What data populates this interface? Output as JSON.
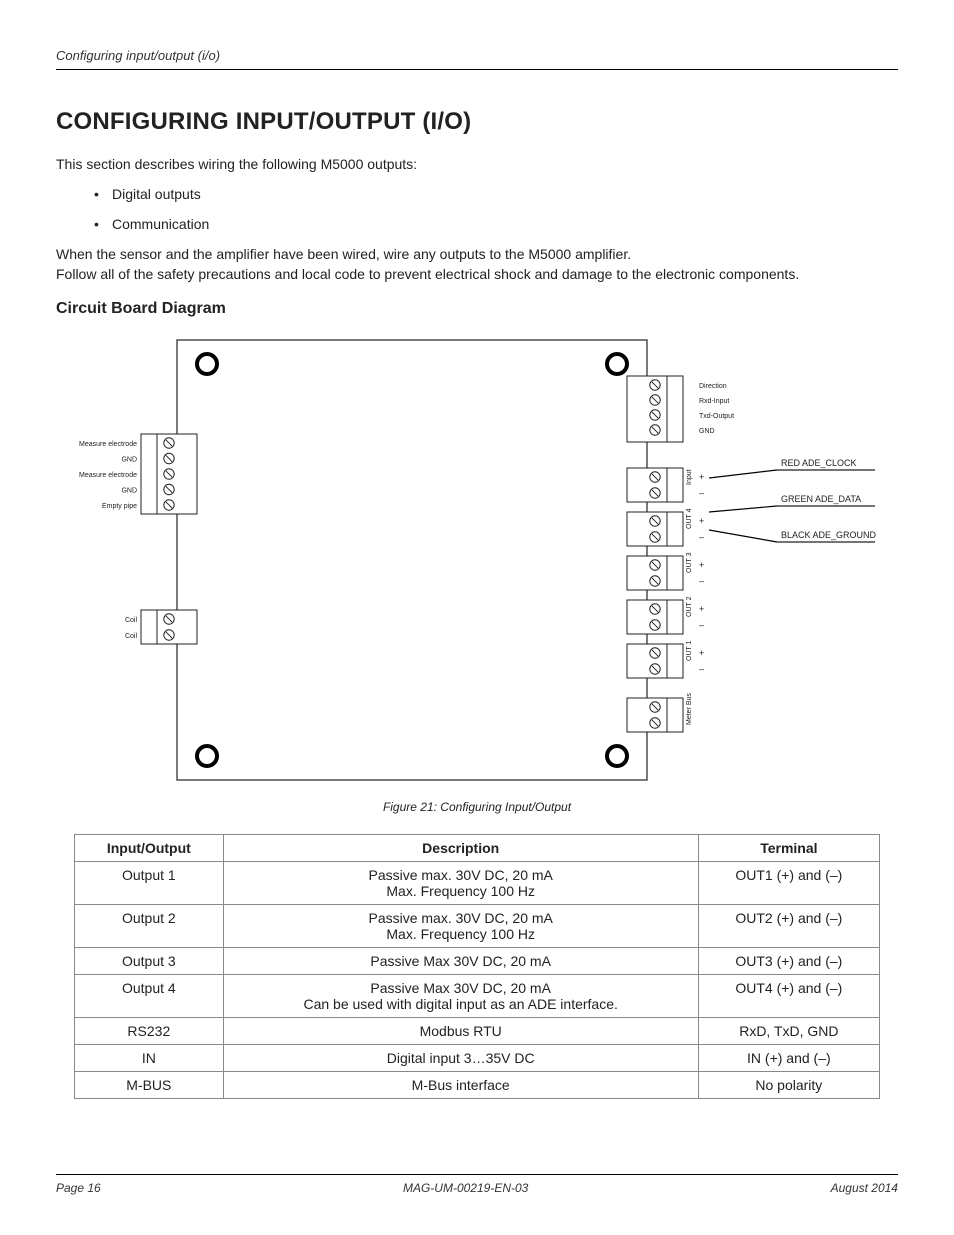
{
  "header": {
    "running_head": "Configuring input/output (i/o)"
  },
  "title": "CONFIGURING INPUT/OUTPUT (I/O)",
  "intro": "This section describes wiring the following M5000 outputs:",
  "bullets": [
    "Digital outputs",
    "Communication"
  ],
  "para1": "When the sensor and the amplifier have been wired, wire any outputs to the M5000 amplifier.",
  "para2": "Follow all of the safety precautions and local code to prevent electrical shock and damage to the electronic components.",
  "subheading": "Circuit Board Diagram",
  "figure_caption": "Figure 21:  Configuring Input/Output",
  "diagram": {
    "left_labels": [
      "Measure electrode",
      "GND",
      "Measure electrode",
      "GND",
      "Empty pipe"
    ],
    "coil_labels": [
      "Coil",
      "Coil"
    ],
    "rs232_labels": [
      "Direction",
      "Rxd-Input",
      "Txd-Output",
      "GND"
    ],
    "right_groups": [
      {
        "name": "Input",
        "signs": [
          "+",
          "–"
        ]
      },
      {
        "name": "OUT 4",
        "signs": [
          "+",
          "–"
        ]
      },
      {
        "name": "OUT 3",
        "signs": [
          "+",
          "–"
        ]
      },
      {
        "name": "OUT 2",
        "signs": [
          "+",
          "–"
        ]
      },
      {
        "name": "OUT 1",
        "signs": [
          "+",
          "–"
        ]
      },
      {
        "name": "Meter Bus",
        "signs": [
          "",
          ""
        ]
      }
    ],
    "wire_labels": [
      "RED ADE_CLOCK",
      "GREEN ADE_DATA",
      "BLACK ADE_GROUND"
    ]
  },
  "table": {
    "headers": [
      "Input/Output",
      "Description",
      "Terminal"
    ],
    "rows": [
      {
        "io": "Output 1",
        "desc": [
          "Passive max. 30V DC, 20 mA",
          "Max. Frequency 100 Hz"
        ],
        "term": "OUT1 (+) and (–)"
      },
      {
        "io": "Output 2",
        "desc": [
          "Passive max. 30V DC, 20 mA",
          "Max. Frequency 100 Hz"
        ],
        "term": "OUT2 (+) and (–)"
      },
      {
        "io": "Output 3",
        "desc": [
          "Passive Max 30V DC, 20 mA"
        ],
        "term": "OUT3 (+) and (–)"
      },
      {
        "io": "Output 4",
        "desc": [
          "Passive Max 30V DC, 20 mA",
          "Can be used with digital input as an ADE interface."
        ],
        "term": "OUT4 (+) and (–)"
      },
      {
        "io": "RS232",
        "desc": [
          "Modbus RTU"
        ],
        "term": "RxD, TxD, GND"
      },
      {
        "io": "IN",
        "desc": [
          "Digital input 3…35V DC"
        ],
        "term": "IN (+) and (–)"
      },
      {
        "io": "M-BUS",
        "desc": [
          "M-Bus interface"
        ],
        "term": "No polarity"
      }
    ]
  },
  "footer": {
    "left": "Page 16",
    "center": "MAG-UM-00219-EN-03",
    "right": "August 2014"
  }
}
